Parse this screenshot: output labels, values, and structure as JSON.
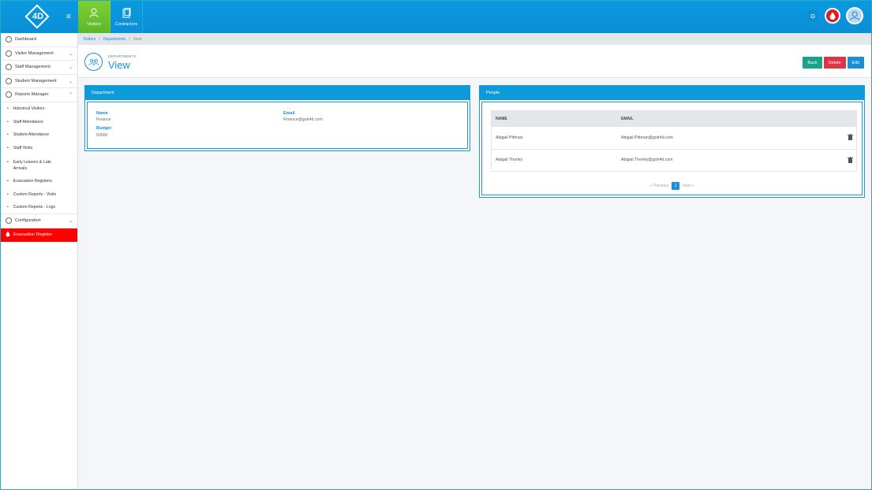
{
  "brand": {
    "logo_text": "4D"
  },
  "top_nav": {
    "tabs": [
      {
        "label": "Visitors",
        "icon": "user-icon",
        "active": true
      },
      {
        "label": "Contractors",
        "icon": "clipboard-icon",
        "active": false
      }
    ]
  },
  "sidebar": {
    "items": [
      {
        "label": "Dashboard",
        "icon": "dashboard-icon"
      },
      {
        "label": "Visitor Management",
        "icon": "user-icon"
      },
      {
        "label": "Staff Management",
        "icon": "id-card-icon"
      },
      {
        "label": "Student Management",
        "icon": "student-icon"
      },
      {
        "label": "Reports Manager",
        "icon": "reports-icon"
      }
    ],
    "reports_sub": [
      "Historical Visitors",
      "Staff Attendance",
      "Student Attendance",
      "Staff Visits",
      "Early Leavers & Late Arrivals",
      "Evacuation Registers",
      "Custom Reports - Visits",
      "Custom Reports - Logs"
    ],
    "configuration": "Configuration",
    "evacuation": "Evacuation Register"
  },
  "breadcrumb": {
    "items": [
      "Visitors",
      "Departments",
      "View"
    ]
  },
  "header": {
    "section": "DEPARTMENTS",
    "title": "View",
    "buttons": {
      "back": "Back",
      "delete": "Delete",
      "edit": "Edit"
    }
  },
  "department": {
    "panel_title": "Department",
    "name_label": "Name",
    "name_value": "Finance",
    "email_label": "Email",
    "email_value": "Finance@gotr4d.com",
    "budget_label": "Budget",
    "budget_value": "50000"
  },
  "people": {
    "panel_title": "People",
    "columns": [
      "NAME",
      "EMAIL"
    ],
    "rows": [
      {
        "name": "Abigail Pittman",
        "email": "Abigail.Pittman@gotr4d.com"
      },
      {
        "name": "Abigail Thorley",
        "email": "Abigail.Thorley@gotr4d.com"
      }
    ],
    "pagination": {
      "previous": "« Previous",
      "page": "1",
      "next": "Next »"
    }
  },
  "colors": {
    "primary": "#0d9ad8",
    "active_tab": "#6cc22e",
    "evacuation": "#fe0000",
    "back": "#1aa28a",
    "delete": "#dc3545"
  }
}
